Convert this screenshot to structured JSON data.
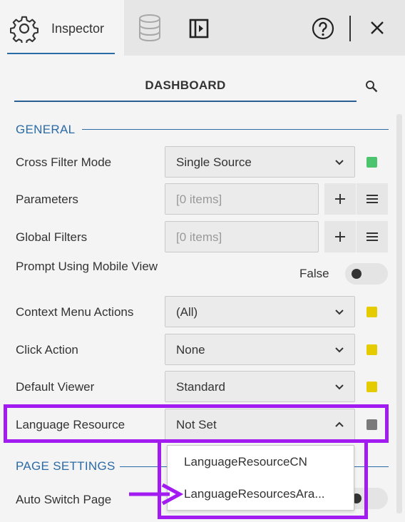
{
  "tabs": {
    "inspector_label": "Inspector",
    "icons": [
      "gear-icon",
      "database-icon",
      "panel-toggle-icon",
      "help-icon",
      "close-icon"
    ]
  },
  "dashboard": {
    "title": "DASHBOARD"
  },
  "sections": {
    "general": "GENERAL",
    "page_settings": "PAGE SETTINGS"
  },
  "rows": {
    "cross_filter_mode": {
      "label": "Cross Filter Mode",
      "value": "Single Source",
      "status_color": "#4cc46e"
    },
    "parameters": {
      "label": "Parameters",
      "placeholder": "[0 items]"
    },
    "global_filters": {
      "label": "Global Filters",
      "placeholder": "[0 items]"
    },
    "prompt_mobile": {
      "label": "Prompt Using Mobile View",
      "value": "False"
    },
    "context_menu_actions": {
      "label": "Context Menu Actions",
      "value": "(All)",
      "status_color": "#e4cc00"
    },
    "click_action": {
      "label": "Click Action",
      "value": "None",
      "status_color": "#e4cc00"
    },
    "default_viewer": {
      "label": "Default Viewer",
      "value": "Standard",
      "status_color": "#e4cc00"
    },
    "language_resource": {
      "label": "Language Resource",
      "value": "Not Set",
      "status_color": "#7a7a7a"
    },
    "auto_switch_page": {
      "label": "Auto Switch Page"
    }
  },
  "language_dropdown": {
    "options": [
      "LanguageResourceCN",
      "LanguageResourcesAra..."
    ]
  },
  "annotation_color": "#a21cf2",
  "accent_color": "#2a6aa6"
}
